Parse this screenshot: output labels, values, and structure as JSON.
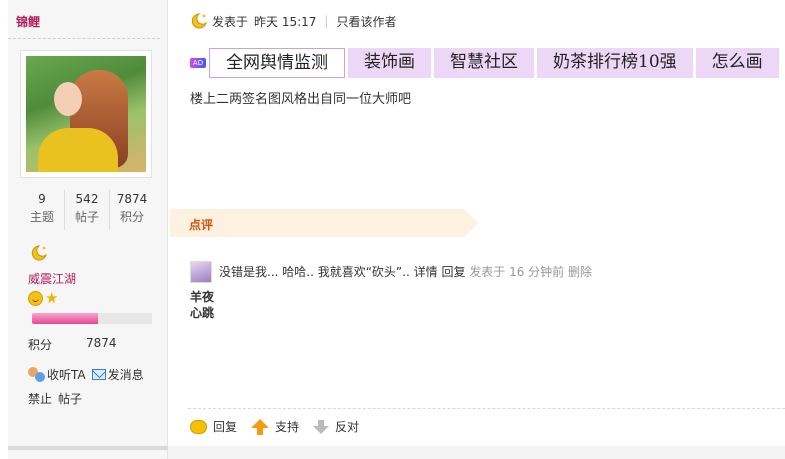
{
  "user": {
    "name": "锦鲤",
    "stats": [
      {
        "value": "9",
        "label": "主题"
      },
      {
        "value": "542",
        "label": "帖子"
      },
      {
        "value": "7874",
        "label": "积分"
      }
    ],
    "rank_title": "威震江湖",
    "level_progress_percent": 55,
    "points_label": "积分",
    "points_value": "7874",
    "actions": {
      "follow": "收听TA",
      "message": "发消息"
    },
    "admin": {
      "ban": "禁止",
      "posts": "帖子"
    }
  },
  "post": {
    "posted_label": "发表于",
    "posted_time": "昨天 15:17",
    "author_only": "只看该作者",
    "body": "楼上二两签名图风格出自同一位大师吧"
  },
  "ad": {
    "badge": "AD",
    "links": [
      "全网舆情监测",
      "装饰画",
      "智慧社区",
      "奶茶排行榜10强",
      "怎么画"
    ]
  },
  "comments": {
    "section_label": "点评",
    "items": [
      {
        "author": "羊夜心跳",
        "text": "没错是我... 哈哈.. 我就喜欢“砍头”..",
        "detail": "详情",
        "reply": "回复",
        "time": "发表于 16 分钟前",
        "delete": "删除"
      }
    ]
  },
  "footer": {
    "reply": "回复",
    "support": "支持",
    "oppose": "反对"
  },
  "colors": {
    "accent": "#b01f5c",
    "comment_label": "#d4520a",
    "ad_bg": "#ecd8f6"
  }
}
